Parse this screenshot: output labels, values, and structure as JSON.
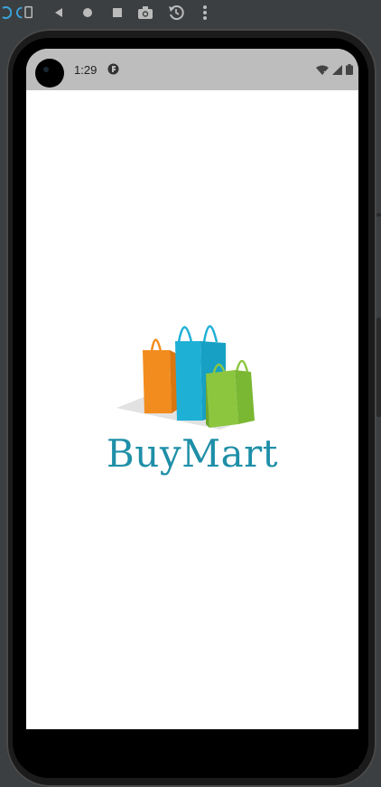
{
  "status_bar": {
    "time": "1:29"
  },
  "app": {
    "brand_name": "BuyMart"
  },
  "colors": {
    "toolbar_bg": "#3c3f41",
    "status_bar_bg": "#bdbdbd",
    "brand_teal": "#1f8fa8",
    "bag_orange": "#f28c1e",
    "bag_blue": "#1fb0d6",
    "bag_green": "#8cc63f"
  },
  "icons": {
    "toolbar": [
      "rotate-left-icon",
      "rotate-right-icon",
      "back-icon",
      "home-icon",
      "overview-icon",
      "camera-icon",
      "snapshot-icon",
      "more-icon"
    ],
    "status_right": [
      "wifi-icon",
      "signal-icon",
      "battery-icon"
    ]
  }
}
